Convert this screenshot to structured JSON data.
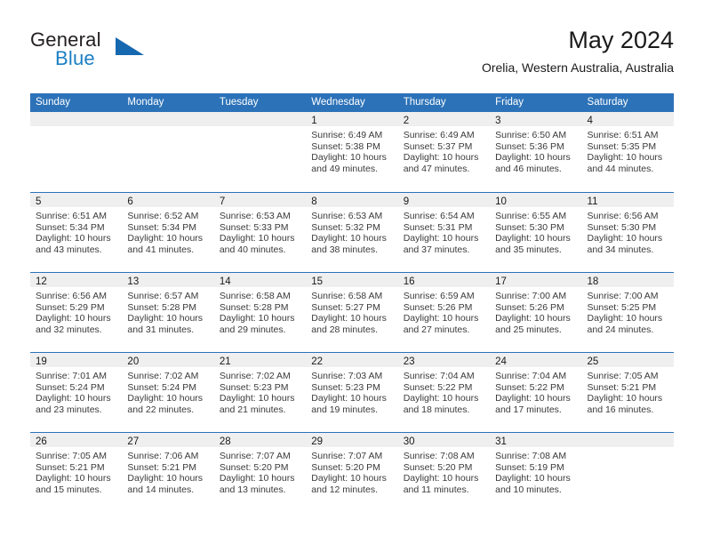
{
  "brand": {
    "name_top": "General",
    "name_bottom": "Blue",
    "logo_icon": "triangle-logo-icon",
    "accent_color": "#1b7fc4"
  },
  "header": {
    "title": "May 2024",
    "subtitle": "Orelia, Western Australia, Australia"
  },
  "calendar": {
    "header_bg": "#2c72b8",
    "day_band_bg": "#efefef",
    "weekdays": [
      "Sunday",
      "Monday",
      "Tuesday",
      "Wednesday",
      "Thursday",
      "Friday",
      "Saturday"
    ],
    "weeks": [
      [
        {
          "day": "",
          "sunrise": "",
          "sunset": "",
          "daylight": ""
        },
        {
          "day": "",
          "sunrise": "",
          "sunset": "",
          "daylight": ""
        },
        {
          "day": "",
          "sunrise": "",
          "sunset": "",
          "daylight": ""
        },
        {
          "day": "1",
          "sunrise": "Sunrise: 6:49 AM",
          "sunset": "Sunset: 5:38 PM",
          "daylight": "Daylight: 10 hours and 49 minutes."
        },
        {
          "day": "2",
          "sunrise": "Sunrise: 6:49 AM",
          "sunset": "Sunset: 5:37 PM",
          "daylight": "Daylight: 10 hours and 47 minutes."
        },
        {
          "day": "3",
          "sunrise": "Sunrise: 6:50 AM",
          "sunset": "Sunset: 5:36 PM",
          "daylight": "Daylight: 10 hours and 46 minutes."
        },
        {
          "day": "4",
          "sunrise": "Sunrise: 6:51 AM",
          "sunset": "Sunset: 5:35 PM",
          "daylight": "Daylight: 10 hours and 44 minutes."
        }
      ],
      [
        {
          "day": "5",
          "sunrise": "Sunrise: 6:51 AM",
          "sunset": "Sunset: 5:34 PM",
          "daylight": "Daylight: 10 hours and 43 minutes."
        },
        {
          "day": "6",
          "sunrise": "Sunrise: 6:52 AM",
          "sunset": "Sunset: 5:34 PM",
          "daylight": "Daylight: 10 hours and 41 minutes."
        },
        {
          "day": "7",
          "sunrise": "Sunrise: 6:53 AM",
          "sunset": "Sunset: 5:33 PM",
          "daylight": "Daylight: 10 hours and 40 minutes."
        },
        {
          "day": "8",
          "sunrise": "Sunrise: 6:53 AM",
          "sunset": "Sunset: 5:32 PM",
          "daylight": "Daylight: 10 hours and 38 minutes."
        },
        {
          "day": "9",
          "sunrise": "Sunrise: 6:54 AM",
          "sunset": "Sunset: 5:31 PM",
          "daylight": "Daylight: 10 hours and 37 minutes."
        },
        {
          "day": "10",
          "sunrise": "Sunrise: 6:55 AM",
          "sunset": "Sunset: 5:30 PM",
          "daylight": "Daylight: 10 hours and 35 minutes."
        },
        {
          "day": "11",
          "sunrise": "Sunrise: 6:56 AM",
          "sunset": "Sunset: 5:30 PM",
          "daylight": "Daylight: 10 hours and 34 minutes."
        }
      ],
      [
        {
          "day": "12",
          "sunrise": "Sunrise: 6:56 AM",
          "sunset": "Sunset: 5:29 PM",
          "daylight": "Daylight: 10 hours and 32 minutes."
        },
        {
          "day": "13",
          "sunrise": "Sunrise: 6:57 AM",
          "sunset": "Sunset: 5:28 PM",
          "daylight": "Daylight: 10 hours and 31 minutes."
        },
        {
          "day": "14",
          "sunrise": "Sunrise: 6:58 AM",
          "sunset": "Sunset: 5:28 PM",
          "daylight": "Daylight: 10 hours and 29 minutes."
        },
        {
          "day": "15",
          "sunrise": "Sunrise: 6:58 AM",
          "sunset": "Sunset: 5:27 PM",
          "daylight": "Daylight: 10 hours and 28 minutes."
        },
        {
          "day": "16",
          "sunrise": "Sunrise: 6:59 AM",
          "sunset": "Sunset: 5:26 PM",
          "daylight": "Daylight: 10 hours and 27 minutes."
        },
        {
          "day": "17",
          "sunrise": "Sunrise: 7:00 AM",
          "sunset": "Sunset: 5:26 PM",
          "daylight": "Daylight: 10 hours and 25 minutes."
        },
        {
          "day": "18",
          "sunrise": "Sunrise: 7:00 AM",
          "sunset": "Sunset: 5:25 PM",
          "daylight": "Daylight: 10 hours and 24 minutes."
        }
      ],
      [
        {
          "day": "19",
          "sunrise": "Sunrise: 7:01 AM",
          "sunset": "Sunset: 5:24 PM",
          "daylight": "Daylight: 10 hours and 23 minutes."
        },
        {
          "day": "20",
          "sunrise": "Sunrise: 7:02 AM",
          "sunset": "Sunset: 5:24 PM",
          "daylight": "Daylight: 10 hours and 22 minutes."
        },
        {
          "day": "21",
          "sunrise": "Sunrise: 7:02 AM",
          "sunset": "Sunset: 5:23 PM",
          "daylight": "Daylight: 10 hours and 21 minutes."
        },
        {
          "day": "22",
          "sunrise": "Sunrise: 7:03 AM",
          "sunset": "Sunset: 5:23 PM",
          "daylight": "Daylight: 10 hours and 19 minutes."
        },
        {
          "day": "23",
          "sunrise": "Sunrise: 7:04 AM",
          "sunset": "Sunset: 5:22 PM",
          "daylight": "Daylight: 10 hours and 18 minutes."
        },
        {
          "day": "24",
          "sunrise": "Sunrise: 7:04 AM",
          "sunset": "Sunset: 5:22 PM",
          "daylight": "Daylight: 10 hours and 17 minutes."
        },
        {
          "day": "25",
          "sunrise": "Sunrise: 7:05 AM",
          "sunset": "Sunset: 5:21 PM",
          "daylight": "Daylight: 10 hours and 16 minutes."
        }
      ],
      [
        {
          "day": "26",
          "sunrise": "Sunrise: 7:05 AM",
          "sunset": "Sunset: 5:21 PM",
          "daylight": "Daylight: 10 hours and 15 minutes."
        },
        {
          "day": "27",
          "sunrise": "Sunrise: 7:06 AM",
          "sunset": "Sunset: 5:21 PM",
          "daylight": "Daylight: 10 hours and 14 minutes."
        },
        {
          "day": "28",
          "sunrise": "Sunrise: 7:07 AM",
          "sunset": "Sunset: 5:20 PM",
          "daylight": "Daylight: 10 hours and 13 minutes."
        },
        {
          "day": "29",
          "sunrise": "Sunrise: 7:07 AM",
          "sunset": "Sunset: 5:20 PM",
          "daylight": "Daylight: 10 hours and 12 minutes."
        },
        {
          "day": "30",
          "sunrise": "Sunrise: 7:08 AM",
          "sunset": "Sunset: 5:20 PM",
          "daylight": "Daylight: 10 hours and 11 minutes."
        },
        {
          "day": "31",
          "sunrise": "Sunrise: 7:08 AM",
          "sunset": "Sunset: 5:19 PM",
          "daylight": "Daylight: 10 hours and 10 minutes."
        },
        {
          "day": "",
          "sunrise": "",
          "sunset": "",
          "daylight": ""
        }
      ]
    ]
  }
}
